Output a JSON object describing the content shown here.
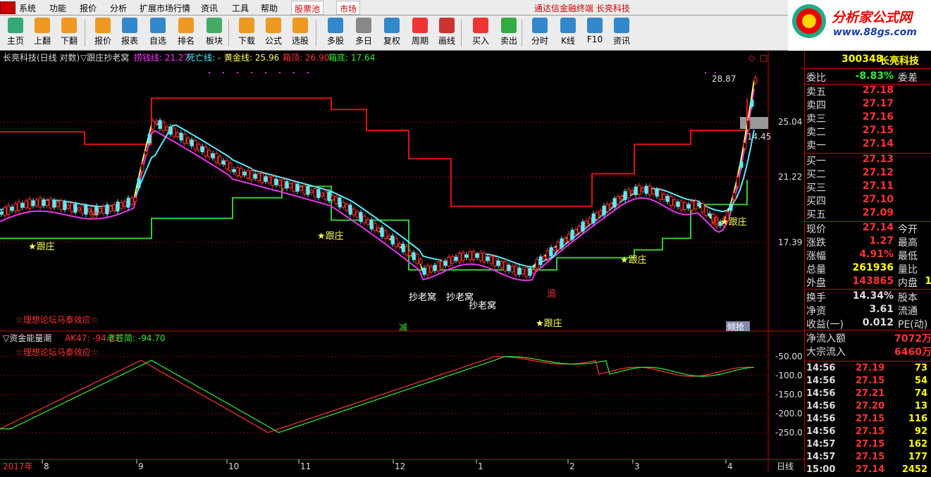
{
  "menu": {
    "items": [
      "系统",
      "功能",
      "报价",
      "分析",
      "扩展市场行情",
      "资讯",
      "工具",
      "帮助"
    ],
    "tab_pool": "股票池",
    "tab_market": "市场",
    "brand": "通达信金融终端  长亮科技"
  },
  "toolbar": {
    "buttons": [
      "主页",
      "上翻",
      "下翻",
      "报价",
      "报表",
      "自选",
      "排名",
      "板块",
      "下载",
      "公式",
      "选股",
      "多股",
      "多日",
      "复权",
      "周期",
      "画线",
      "买入",
      "卖出",
      "分时",
      "K线",
      "F10",
      "资讯"
    ]
  },
  "site": {
    "name": "分析家公式网",
    "url": "www.88gs.com"
  },
  "main_header": {
    "title": "长亮科技(日线 对数)",
    "indicator": "▽跟庄抄老窝",
    "l1": "捞钱线: 21.27",
    "l2": "死亡线: -",
    "l3": "黄金线: 25.96",
    "l4": "箱顶: 26.90",
    "l5": "箱底: 17.64"
  },
  "price_axis": [
    "25.04",
    "21.22",
    "17.39"
  ],
  "price_marks": {
    "high": "28.87",
    "low": "14.45"
  },
  "annotations": {
    "gz": "★跟庄",
    "clw": "抄老窝",
    "zhui": "追",
    "jian": "减",
    "qiang": "倾抢",
    "watermark": "☆理想论坛马泰效应☆",
    "gz_bottom": "★跟庄"
  },
  "sub_header": {
    "title": "▽资金能量潮",
    "ak": "AK47: -94.31",
    "lcc": "老苍简: -94.70"
  },
  "sub_axis": [
    "-50.00",
    "-100.0",
    "-150.0",
    "-200.0",
    "-250.0"
  ],
  "date_axis": {
    "year": "2017年",
    "months": [
      "8",
      "9",
      "10",
      "11",
      "12",
      "1",
      "2",
      "3",
      "4"
    ],
    "period": "日线"
  },
  "quote": {
    "code": "300348",
    "name": "长亮科技",
    "wb": {
      "label": "委比",
      "value": "-8.83%",
      "label2": "委差"
    },
    "sell": [
      {
        "k": "卖五",
        "v": "27.18"
      },
      {
        "k": "卖四",
        "v": "27.17"
      },
      {
        "k": "卖三",
        "v": "27.16"
      },
      {
        "k": "卖二",
        "v": "27.15"
      },
      {
        "k": "卖一",
        "v": "27.14"
      }
    ],
    "buy": [
      {
        "k": "买一",
        "v": "27.13"
      },
      {
        "k": "买二",
        "v": "27.12"
      },
      {
        "k": "买三",
        "v": "27.11"
      },
      {
        "k": "买四",
        "v": "27.10"
      },
      {
        "k": "买五",
        "v": "27.09"
      }
    ],
    "stats": [
      {
        "k": "现价",
        "v": "27.14",
        "k2": "今开"
      },
      {
        "k": "涨跌",
        "v": "1.27",
        "k2": "最高"
      },
      {
        "k": "涨幅",
        "v": "4.91%",
        "k2": "最低"
      },
      {
        "k": "总量",
        "v": "261936",
        "k2": "量比"
      },
      {
        "k": "外盘",
        "v": "143865",
        "k2": "内盘",
        "v2": "1"
      }
    ],
    "fin": [
      {
        "k": "换手",
        "v": "14.34%",
        "k2": "股本"
      },
      {
        "k": "净资",
        "v": "3.61",
        "k2": "流通"
      },
      {
        "k": "收益(一)",
        "v": "0.012",
        "k2": "PE(动)"
      }
    ],
    "flow": [
      {
        "k": "净流入额",
        "v": "7072万"
      },
      {
        "k": "大宗流入",
        "v": "6460万"
      }
    ],
    "ticks": [
      [
        "14:56",
        "27.19",
        "73"
      ],
      [
        "14:56",
        "27.15",
        "54"
      ],
      [
        "14:56",
        "27.21",
        "74"
      ],
      [
        "14:56",
        "27.20",
        "13"
      ],
      [
        "14:56",
        "27.15",
        "116"
      ],
      [
        "14:56",
        "27.15",
        "92"
      ],
      [
        "14:57",
        "27.15",
        "162"
      ],
      [
        "14:57",
        "27.15",
        "177"
      ],
      [
        "15:00",
        "27.14",
        "2452"
      ]
    ]
  },
  "chart_data": {
    "type": "line",
    "note_series": [
      {
        "name": "箱顶",
        "values": [
          24.3,
          24.3,
          23.4,
          23.4,
          26.9,
          26.9,
          26.9,
          26.0,
          24.4,
          22.4,
          19.4,
          19.4,
          19.4,
          19.4,
          21.4,
          23.4,
          23.4,
          24.4,
          26.9
        ]
      },
      {
        "name": "箱底",
        "values": [
          17.6,
          17.6,
          17.6,
          17.6,
          18.7,
          19.9,
          20.6,
          18.6,
          18.6,
          16.0,
          16.0,
          16.0,
          16.0,
          16.6,
          16.6,
          17.0,
          17.6,
          19.5,
          21.0
        ]
      }
    ]
  }
}
